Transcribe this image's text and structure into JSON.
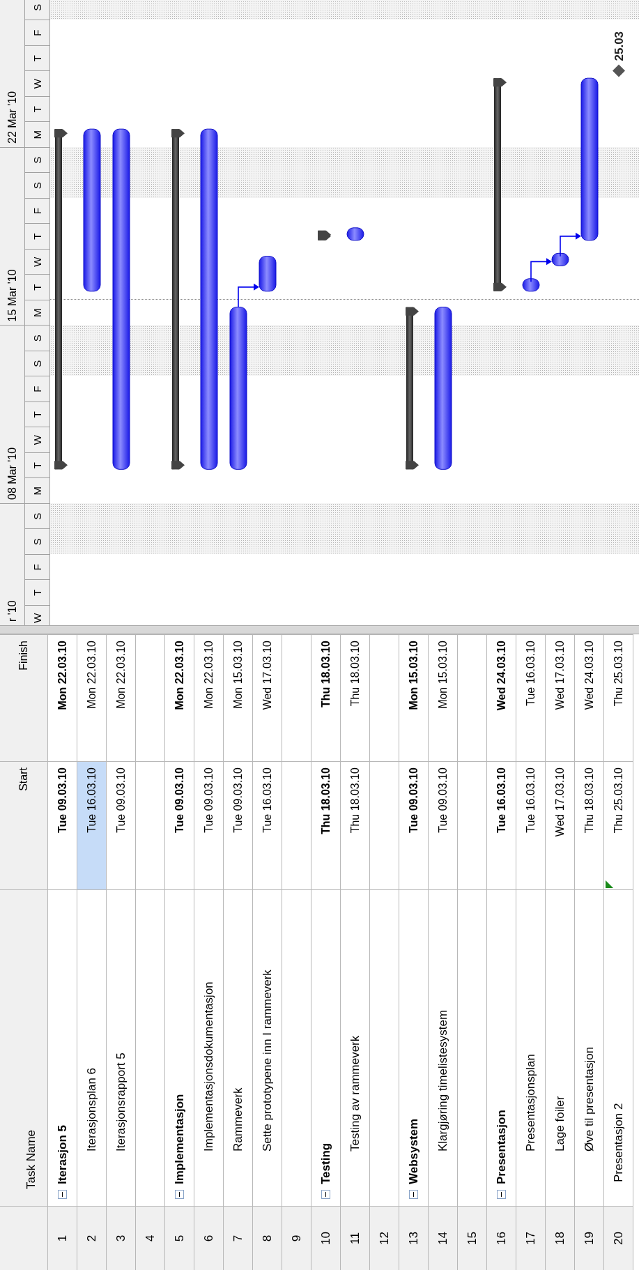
{
  "columns": [
    "Task Name",
    "Start",
    "Finish"
  ],
  "timescale": {
    "weeks": [
      "r '10",
      "08 Mar '10",
      "15 Mar '10",
      "22 Mar '10"
    ],
    "days": [
      {
        "letter": "W",
        "weekend": false,
        "current": false
      },
      {
        "letter": "T",
        "weekend": false,
        "current": false
      },
      {
        "letter": "F",
        "weekend": false,
        "current": false
      },
      {
        "letter": "S",
        "weekend": true,
        "current": false
      },
      {
        "letter": "S",
        "weekend": true,
        "current": false
      },
      {
        "letter": "M",
        "weekend": false,
        "current": false
      },
      {
        "letter": "T",
        "weekend": false,
        "current": false
      },
      {
        "letter": "W",
        "weekend": false,
        "current": false
      },
      {
        "letter": "T",
        "weekend": false,
        "current": false
      },
      {
        "letter": "F",
        "weekend": false,
        "current": false
      },
      {
        "letter": "S",
        "weekend": true,
        "current": false
      },
      {
        "letter": "S",
        "weekend": true,
        "current": false
      },
      {
        "letter": "M",
        "weekend": false,
        "current": false
      },
      {
        "letter": "T",
        "weekend": false,
        "current": true
      },
      {
        "letter": "W",
        "weekend": false,
        "current": false
      },
      {
        "letter": "T",
        "weekend": false,
        "current": false
      },
      {
        "letter": "F",
        "weekend": false,
        "current": false
      },
      {
        "letter": "S",
        "weekend": true,
        "current": false
      },
      {
        "letter": "S",
        "weekend": true,
        "current": false
      },
      {
        "letter": "M",
        "weekend": false,
        "current": false
      },
      {
        "letter": "T",
        "weekend": false,
        "current": false
      },
      {
        "letter": "W",
        "weekend": false,
        "current": false
      },
      {
        "letter": "T",
        "weekend": false,
        "current": false
      },
      {
        "letter": "F",
        "weekend": false,
        "current": false
      },
      {
        "letter": "S",
        "weekend": true,
        "current": false
      }
    ]
  },
  "tasks": [
    {
      "id": "1",
      "name": "Iterasjon 5",
      "start": "Tue 09.03.10",
      "finish": "Mon 22.03.10",
      "kind": "summary",
      "expanded": true,
      "start_selected": false,
      "indicator": false,
      "linked": false,
      "children": [
        {
          "id": "2",
          "name": "Iterasjonsplan 6",
          "start": "Tue 16.03.10",
          "finish": "Mon 22.03.10",
          "kind": "task",
          "start_selected": true,
          "indicator": false,
          "linked": false
        },
        {
          "id": "3",
          "name": "Iterasjonsrapport 5",
          "start": "Tue 09.03.10",
          "finish": "Mon 22.03.10",
          "kind": "task",
          "start_selected": false,
          "indicator": false,
          "linked": false
        }
      ]
    },
    {
      "id": "4",
      "kind": "blank",
      "start_selected": false,
      "indicator": false,
      "linked": false
    },
    {
      "id": "5",
      "name": "Implementasjon",
      "start": "Tue 09.03.10",
      "finish": "Mon 22.03.10",
      "kind": "summary",
      "expanded": true,
      "start_selected": false,
      "indicator": false,
      "linked": false,
      "children": [
        {
          "id": "6",
          "name": "Implementasjonsdokumentasjon",
          "start": "Tue 09.03.10",
          "finish": "Mon 22.03.10",
          "kind": "task",
          "start_selected": false,
          "indicator": false,
          "linked": false
        },
        {
          "id": "7",
          "name": "Rammeverk",
          "start": "Tue 09.03.10",
          "finish": "Mon 15.03.10",
          "kind": "task",
          "start_selected": false,
          "indicator": false,
          "linked": false
        },
        {
          "id": "8",
          "name": "Sette prototypene inn I rammeverk",
          "start": "Tue 16.03.10",
          "finish": "Wed 17.03.10",
          "kind": "task",
          "start_selected": false,
          "indicator": false,
          "linked": true
        }
      ]
    },
    {
      "id": "9",
      "kind": "blank",
      "start_selected": false,
      "indicator": false,
      "linked": false
    },
    {
      "id": "10",
      "name": "Testing",
      "start": "Thu 18.03.10",
      "finish": "Thu 18.03.10",
      "kind": "summary",
      "expanded": true,
      "start_selected": false,
      "indicator": false,
      "linked": false,
      "children": [
        {
          "id": "11",
          "name": "Testing av rammeverk",
          "start": "Thu 18.03.10",
          "finish": "Thu 18.03.10",
          "kind": "task",
          "start_selected": false,
          "indicator": false,
          "linked": false
        }
      ]
    },
    {
      "id": "12",
      "kind": "blank",
      "start_selected": false,
      "indicator": false,
      "linked": false
    },
    {
      "id": "13",
      "name": "Websystem",
      "start": "Tue 09.03.10",
      "finish": "Mon 15.03.10",
      "kind": "summary",
      "expanded": true,
      "start_selected": false,
      "indicator": false,
      "linked": false,
      "children": [
        {
          "id": "14",
          "name": "Klargjøring timelistesystem",
          "start": "Tue 09.03.10",
          "finish": "Mon 15.03.10",
          "kind": "task",
          "start_selected": false,
          "indicator": false,
          "linked": false
        }
      ]
    },
    {
      "id": "15",
      "kind": "blank",
      "start_selected": false,
      "indicator": false,
      "linked": false
    },
    {
      "id": "16",
      "name": "Presentasjon",
      "start": "Tue 16.03.10",
      "finish": "Wed 24.03.10",
      "kind": "summary",
      "expanded": true,
      "start_selected": false,
      "indicator": false,
      "linked": false,
      "children": [
        {
          "id": "17",
          "name": "Presentasjonsplan",
          "start": "Tue 16.03.10",
          "finish": "Tue 16.03.10",
          "kind": "task",
          "start_selected": false,
          "indicator": false,
          "linked": false
        },
        {
          "id": "18",
          "name": "Lage foiler",
          "start": "Wed 17.03.10",
          "finish": "Wed 17.03.10",
          "kind": "task",
          "start_selected": false,
          "indicator": false,
          "linked": true
        },
        {
          "id": "19",
          "name": "Øve til presentasjon",
          "start": "Thu 18.03.10",
          "finish": "Wed 24.03.10",
          "kind": "task",
          "start_selected": false,
          "indicator": false,
          "linked": true
        }
      ]
    },
    {
      "id": "20",
      "name": "Presentasjon 2",
      "start": "Thu 25.03.10",
      "finish": "Thu 25.03.10",
      "kind": "milestone",
      "date_label": "25.03",
      "start_selected": false,
      "indicator": true,
      "linked": false
    }
  ]
}
